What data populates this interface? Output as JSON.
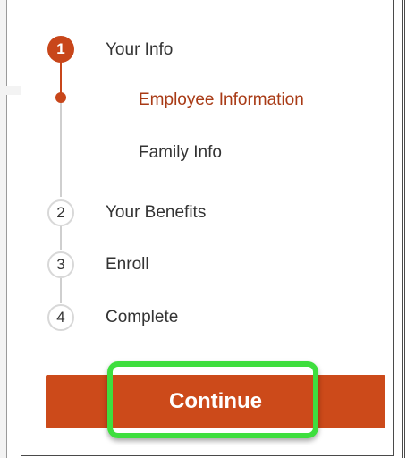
{
  "steps": [
    {
      "number": "1",
      "label": "Your Info"
    },
    {
      "number": "2",
      "label": "Your Benefits"
    },
    {
      "number": "3",
      "label": "Enroll"
    },
    {
      "number": "4",
      "label": "Complete"
    }
  ],
  "sub_steps": [
    {
      "label": "Employee Information"
    },
    {
      "label": "Family Info"
    }
  ],
  "continue_label": "Continue",
  "colors": {
    "accent": "#cc4a1a",
    "active_text": "#a83a15",
    "highlight": "#3ede3e"
  }
}
